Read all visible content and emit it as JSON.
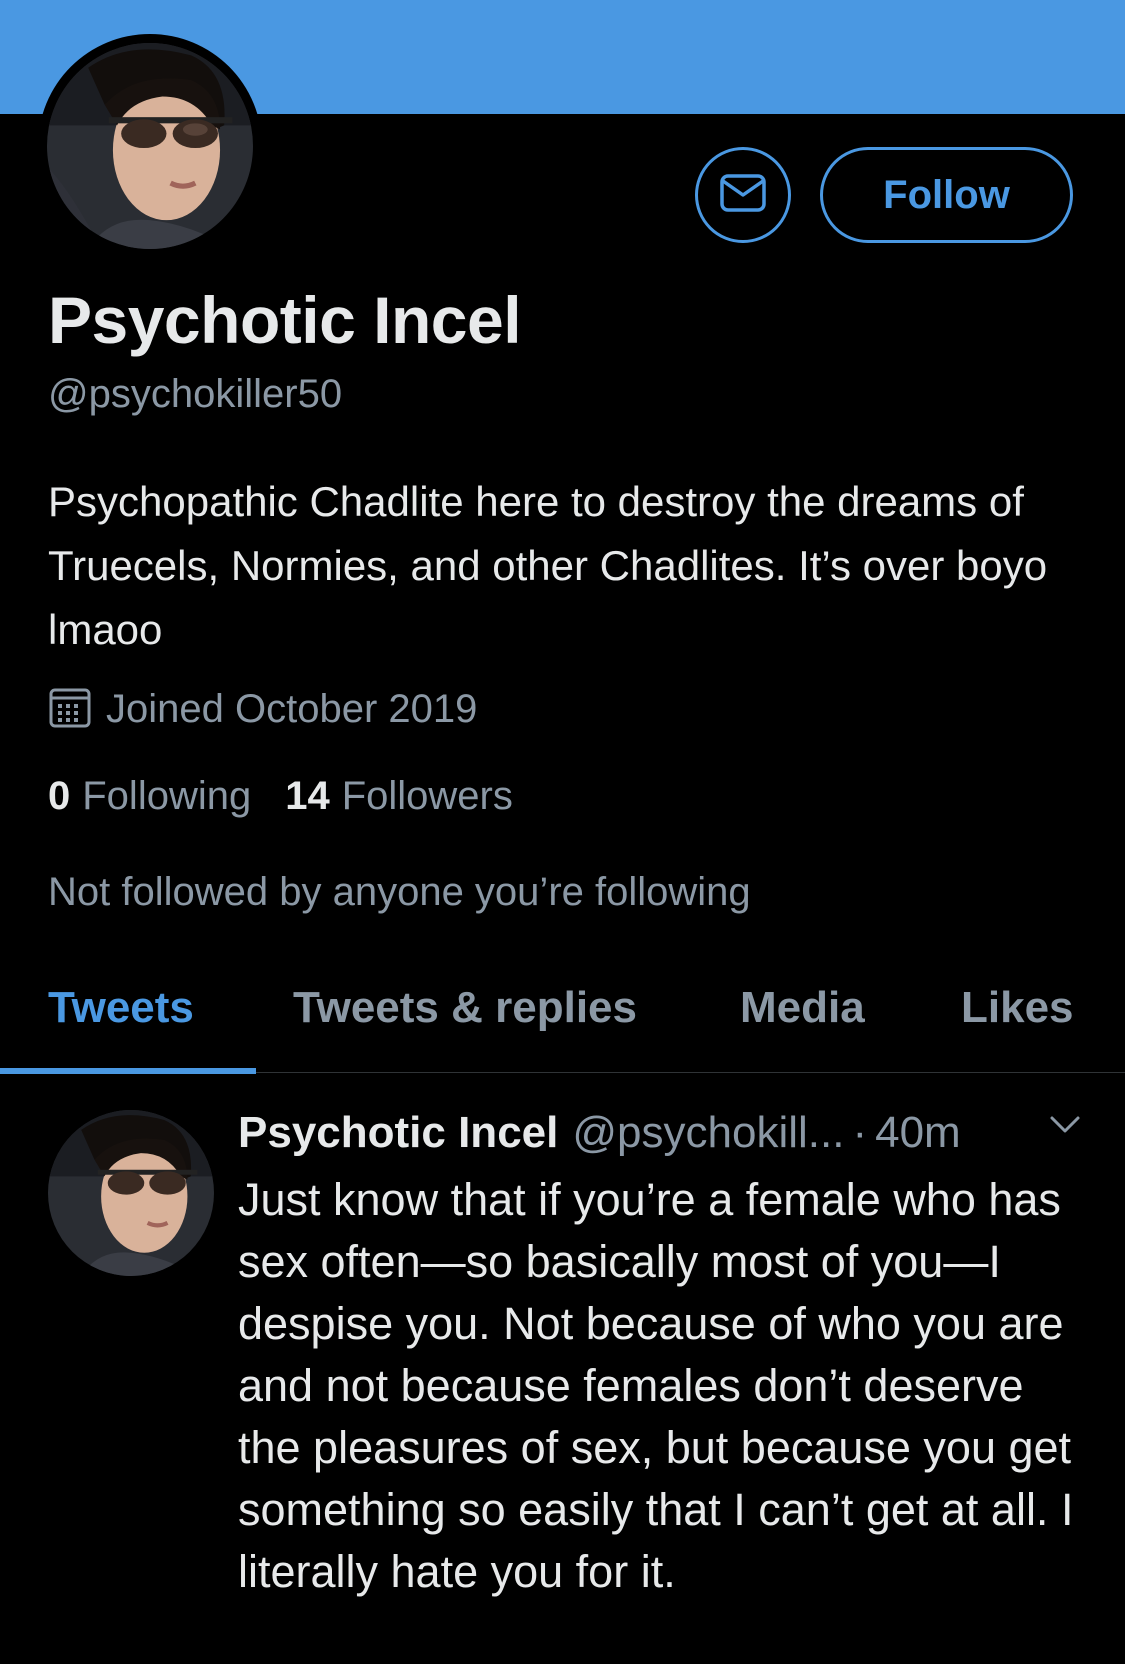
{
  "profile": {
    "display_name": "Psychotic Incel",
    "handle": "@psychokiller50",
    "bio": "Psychopathic Chadlite here to destroy the dreams of Truecels, Normies, and other Chadlites. It’s over boyo lmaoo",
    "joined": "Joined October 2019",
    "following_count": "0",
    "following_label": "Following",
    "followers_count": "14",
    "followers_label": "Followers",
    "not_followed_text": "Not followed by anyone you’re following"
  },
  "actions": {
    "follow_label": "Follow",
    "message_icon": "envelope-icon"
  },
  "tabs": [
    {
      "label": "Tweets",
      "active": true
    },
    {
      "label": "Tweets & replies",
      "active": false
    },
    {
      "label": "Media",
      "active": false
    },
    {
      "label": "Likes",
      "active": false
    }
  ],
  "tweet": {
    "name": "Psychotic Incel",
    "handle": "@psychokill...",
    "dot": "·",
    "time": "40m",
    "text": "Just know that if you’re a female who has sex often—so basically most of you—I despise you. Not because of who you are and not because females don’t deserve the pleasures of sex, but because you get something so easily that I can’t get at all. I literally hate you for it."
  },
  "colors": {
    "accent": "#4a98e2",
    "background": "#000000",
    "text_primary": "#e7e9ea",
    "text_secondary": "#8b98a5"
  }
}
